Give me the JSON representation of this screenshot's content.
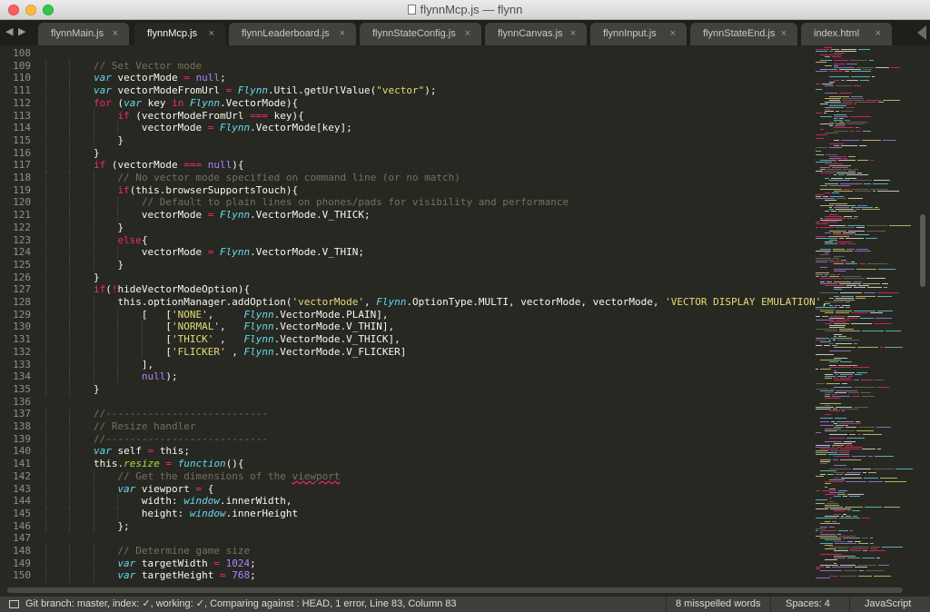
{
  "window": {
    "title": "flynnMcp.js — flynn"
  },
  "tabs": [
    {
      "label": "flynnMain.js",
      "active": false
    },
    {
      "label": "flynnMcp.js",
      "active": true
    },
    {
      "label": "flynnLeaderboard.js",
      "active": false
    },
    {
      "label": "flynnStateConfig.js",
      "active": false
    },
    {
      "label": "flynnCanvas.js",
      "active": false
    },
    {
      "label": "flynnInput.js",
      "active": false
    },
    {
      "label": "flynnStateEnd.js",
      "active": false
    },
    {
      "label": "index.html",
      "active": false
    }
  ],
  "tab_close_glyph": "×",
  "colors": {
    "background": "#272822",
    "keyword": "#f92672",
    "storage": "#66d9ef",
    "string": "#e6db74",
    "number": "#ae81ff",
    "comment": "#75715e",
    "function": "#a6e22e",
    "plain": "#f8f8f2"
  },
  "code": {
    "lines": [
      {
        "n": "108",
        "indent": 0,
        "tokens": []
      },
      {
        "n": "109",
        "indent": 2,
        "tokens": [
          [
            "// Set Vector mode",
            "c"
          ]
        ]
      },
      {
        "n": "110",
        "indent": 2,
        "tokens": [
          [
            "var",
            "s"
          ],
          [
            " vectorMode ",
            ""
          ],
          [
            "=",
            "k"
          ],
          [
            " ",
            ""
          ],
          [
            "null",
            "n"
          ],
          [
            ";",
            ""
          ]
        ]
      },
      {
        "n": "111",
        "indent": 2,
        "tokens": [
          [
            "var",
            "s"
          ],
          [
            " vectorModeFromUrl ",
            ""
          ],
          [
            "=",
            "k"
          ],
          [
            " ",
            ""
          ],
          [
            "Flynn",
            "s"
          ],
          [
            ".Util.getUrlValue(",
            ""
          ],
          [
            "\"vector\"",
            "st"
          ],
          [
            ");",
            ""
          ]
        ]
      },
      {
        "n": "112",
        "indent": 2,
        "tokens": [
          [
            "for",
            "k"
          ],
          [
            " (",
            ""
          ],
          [
            "var",
            "s"
          ],
          [
            " key ",
            ""
          ],
          [
            "in",
            "k"
          ],
          [
            " ",
            ""
          ],
          [
            "Flynn",
            "s"
          ],
          [
            ".VectorMode){",
            ""
          ]
        ]
      },
      {
        "n": "113",
        "indent": 3,
        "tokens": [
          [
            "if",
            "k"
          ],
          [
            " (vectorModeFromUrl ",
            ""
          ],
          [
            "===",
            "k"
          ],
          [
            " key){",
            ""
          ]
        ]
      },
      {
        "n": "114",
        "indent": 4,
        "tokens": [
          [
            "vectorMode ",
            ""
          ],
          [
            "=",
            "k"
          ],
          [
            " ",
            ""
          ],
          [
            "Flynn",
            "s"
          ],
          [
            ".VectorMode[key];",
            ""
          ]
        ]
      },
      {
        "n": "115",
        "indent": 3,
        "tokens": [
          [
            "}",
            ""
          ]
        ]
      },
      {
        "n": "116",
        "indent": 2,
        "tokens": [
          [
            "}",
            ""
          ]
        ]
      },
      {
        "n": "117",
        "indent": 2,
        "tokens": [
          [
            "if",
            "k"
          ],
          [
            " (vectorMode ",
            ""
          ],
          [
            "===",
            "k"
          ],
          [
            " ",
            ""
          ],
          [
            "null",
            "n"
          ],
          [
            "){",
            ""
          ]
        ]
      },
      {
        "n": "118",
        "indent": 3,
        "tokens": [
          [
            "// No vector mode specified on command line (or no match)",
            "c"
          ]
        ]
      },
      {
        "n": "119",
        "indent": 3,
        "tokens": [
          [
            "if",
            "k"
          ],
          [
            "(this.browserSupportsTouch){",
            ""
          ]
        ]
      },
      {
        "n": "120",
        "indent": 4,
        "tokens": [
          [
            "// Default to plain lines on phones/pads for visibility and performance",
            "c"
          ]
        ]
      },
      {
        "n": "121",
        "indent": 4,
        "tokens": [
          [
            "vectorMode ",
            ""
          ],
          [
            "=",
            "k"
          ],
          [
            " ",
            ""
          ],
          [
            "Flynn",
            "s"
          ],
          [
            ".VectorMode.V_THICK;",
            ""
          ]
        ]
      },
      {
        "n": "122",
        "indent": 3,
        "tokens": [
          [
            "}",
            ""
          ]
        ]
      },
      {
        "n": "123",
        "indent": 3,
        "tokens": [
          [
            "else",
            "k"
          ],
          [
            "{",
            ""
          ]
        ]
      },
      {
        "n": "124",
        "indent": 4,
        "tokens": [
          [
            "vectorMode ",
            ""
          ],
          [
            "=",
            "k"
          ],
          [
            " ",
            ""
          ],
          [
            "Flynn",
            "s"
          ],
          [
            ".VectorMode.V_THIN;",
            ""
          ]
        ]
      },
      {
        "n": "125",
        "indent": 3,
        "tokens": [
          [
            "}",
            ""
          ]
        ]
      },
      {
        "n": "126",
        "indent": 2,
        "tokens": [
          [
            "}",
            ""
          ]
        ]
      },
      {
        "n": "127",
        "indent": 2,
        "tokens": [
          [
            "if",
            "k"
          ],
          [
            "(",
            ""
          ],
          [
            "!",
            "k"
          ],
          [
            "hideVectorModeOption){",
            ""
          ]
        ]
      },
      {
        "n": "128",
        "indent": 3,
        "tokens": [
          [
            "this.optionManager.addOption(",
            ""
          ],
          [
            "'vectorMode'",
            "st"
          ],
          [
            ", ",
            ""
          ],
          [
            "Flynn",
            "s"
          ],
          [
            ".OptionType.MULTI, vectorMode, vectorMode, ",
            ""
          ],
          [
            "'VECTOR DISPLAY EMULATION'",
            "st"
          ],
          [
            ",",
            ""
          ]
        ]
      },
      {
        "n": "129",
        "indent": 4,
        "tokens": [
          [
            "[   [",
            ""
          ],
          [
            "'NONE'",
            "st"
          ],
          [
            ",     ",
            ""
          ],
          [
            "Flynn",
            "s"
          ],
          [
            ".VectorMode.PLAIN],",
            ""
          ]
        ]
      },
      {
        "n": "130",
        "indent": 5,
        "tokens": [
          [
            "[",
            ""
          ],
          [
            "'NORMAL'",
            "st"
          ],
          [
            ",   ",
            ""
          ],
          [
            "Flynn",
            "s"
          ],
          [
            ".VectorMode.V_THIN],",
            ""
          ]
        ]
      },
      {
        "n": "131",
        "indent": 5,
        "tokens": [
          [
            "[",
            ""
          ],
          [
            "'THICK'",
            "st"
          ],
          [
            " ,   ",
            ""
          ],
          [
            "Flynn",
            "s"
          ],
          [
            ".VectorMode.V_THICK],",
            ""
          ]
        ]
      },
      {
        "n": "132",
        "indent": 5,
        "tokens": [
          [
            "[",
            ""
          ],
          [
            "'FLICKER'",
            "st"
          ],
          [
            " , ",
            ""
          ],
          [
            "Flynn",
            "s"
          ],
          [
            ".VectorMode.V_FLICKER]",
            ""
          ]
        ]
      },
      {
        "n": "133",
        "indent": 4,
        "tokens": [
          [
            "],",
            ""
          ]
        ]
      },
      {
        "n": "134",
        "indent": 4,
        "tokens": [
          [
            "null",
            "n"
          ],
          [
            ");",
            ""
          ]
        ]
      },
      {
        "n": "135",
        "indent": 2,
        "tokens": [
          [
            "}",
            ""
          ]
        ]
      },
      {
        "n": "136",
        "indent": 0,
        "tokens": []
      },
      {
        "n": "137",
        "indent": 2,
        "tokens": [
          [
            "//---------------------------",
            "c"
          ]
        ]
      },
      {
        "n": "138",
        "indent": 2,
        "tokens": [
          [
            "// Resize handler",
            "c"
          ]
        ]
      },
      {
        "n": "139",
        "indent": 2,
        "tokens": [
          [
            "//---------------------------",
            "c"
          ]
        ]
      },
      {
        "n": "140",
        "indent": 2,
        "tokens": [
          [
            "var",
            "s"
          ],
          [
            " self ",
            ""
          ],
          [
            "=",
            "k"
          ],
          [
            " this;",
            ""
          ]
        ]
      },
      {
        "n": "141",
        "indent": 2,
        "tokens": [
          [
            "this.",
            ""
          ],
          [
            "resize",
            "f"
          ],
          [
            " ",
            ""
          ],
          [
            "=",
            "k"
          ],
          [
            " ",
            ""
          ],
          [
            "function",
            "s"
          ],
          [
            "(){",
            ""
          ]
        ]
      },
      {
        "n": "142",
        "indent": 3,
        "tokens": [
          [
            "// Get the dimensions of the ",
            "c"
          ],
          [
            "viewport",
            "cu"
          ]
        ]
      },
      {
        "n": "143",
        "indent": 3,
        "tokens": [
          [
            "var",
            "s"
          ],
          [
            " viewport ",
            ""
          ],
          [
            "=",
            "k"
          ],
          [
            " {",
            ""
          ]
        ]
      },
      {
        "n": "144",
        "indent": 4,
        "tokens": [
          [
            "width: ",
            ""
          ],
          [
            "window",
            "s"
          ],
          [
            ".innerWidth,",
            ""
          ]
        ]
      },
      {
        "n": "145",
        "indent": 4,
        "tokens": [
          [
            "height: ",
            ""
          ],
          [
            "window",
            "s"
          ],
          [
            ".innerHeight",
            ""
          ]
        ]
      },
      {
        "n": "146",
        "indent": 3,
        "tokens": [
          [
            "};",
            ""
          ]
        ]
      },
      {
        "n": "147",
        "indent": 0,
        "tokens": []
      },
      {
        "n": "148",
        "indent": 3,
        "tokens": [
          [
            "// Determine game size",
            "c"
          ]
        ]
      },
      {
        "n": "149",
        "indent": 3,
        "tokens": [
          [
            "var",
            "s"
          ],
          [
            " targetWidth ",
            ""
          ],
          [
            "=",
            "k"
          ],
          [
            " ",
            ""
          ],
          [
            "1024",
            "n"
          ],
          [
            ";",
            ""
          ]
        ]
      },
      {
        "n": "150",
        "indent": 3,
        "tokens": [
          [
            "var",
            "s"
          ],
          [
            " targetHeight ",
            ""
          ],
          [
            "=",
            "k"
          ],
          [
            " ",
            ""
          ],
          [
            "768",
            "n"
          ],
          [
            ";",
            ""
          ]
        ]
      }
    ]
  },
  "status": {
    "git": "Git branch: master, index: ✓, working: ✓, Comparing against : HEAD, 1 error, Line 83, Column 83",
    "spelling": "8 misspelled words",
    "spaces": "Spaces: 4",
    "syntax": "JavaScript"
  }
}
